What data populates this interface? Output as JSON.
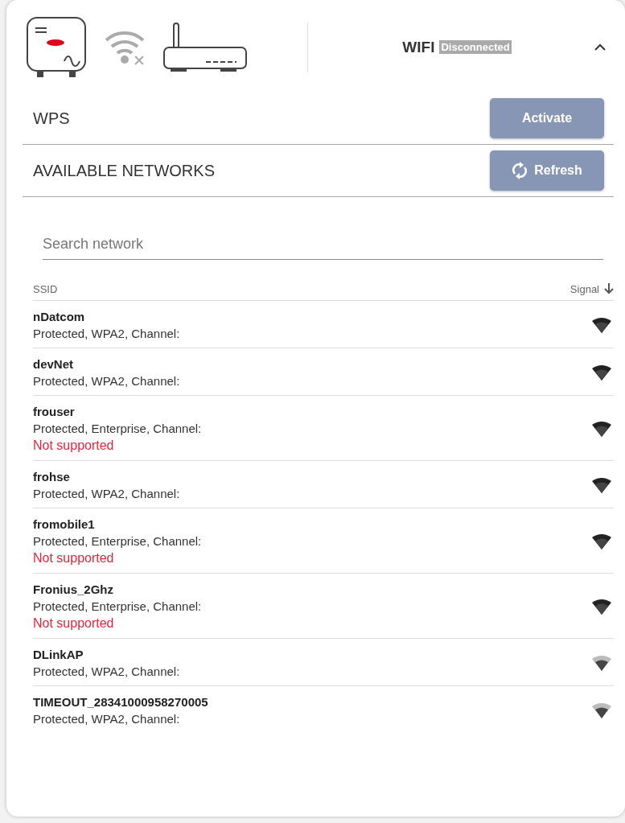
{
  "header": {
    "title": "WIFI",
    "status": "Disconnected",
    "expanded": true
  },
  "wps": {
    "label": "WPS",
    "button": "Activate"
  },
  "networks": {
    "label": "AVAILABLE NETWORKS",
    "button": "Refresh"
  },
  "search": {
    "placeholder": "Search network"
  },
  "table": {
    "columns": [
      "SSID",
      "Signal"
    ],
    "rows": [
      {
        "ssid": "nDatcom",
        "details": "Protected, WPA2, Channel:",
        "full_signal": true
      },
      {
        "ssid": "devNet",
        "details": "Protected, WPA2, Channel:",
        "full_signal": true
      },
      {
        "ssid": "frouser",
        "details": "Protected, Enterprise, Channel:",
        "warning": "Not supported",
        "full_signal": true
      },
      {
        "ssid": "frohse",
        "details": "Protected, WPA2, Channel:",
        "full_signal": true
      },
      {
        "ssid": "fromobile1",
        "details": "Protected, Enterprise, Channel:",
        "warning": "Not supported",
        "full_signal": true
      },
      {
        "ssid": "Fronius_2Ghz",
        "details": "Protected, Enterprise, Channel:",
        "warning": "Not supported",
        "full_signal": true
      },
      {
        "ssid": "DLinkAP",
        "details": "Protected, WPA2, Channel:",
        "full_signal": false
      },
      {
        "ssid": "TIMEOUT_28341000958270005",
        "details": "Protected, WPA2, Channel:",
        "full_signal": false
      }
    ]
  }
}
